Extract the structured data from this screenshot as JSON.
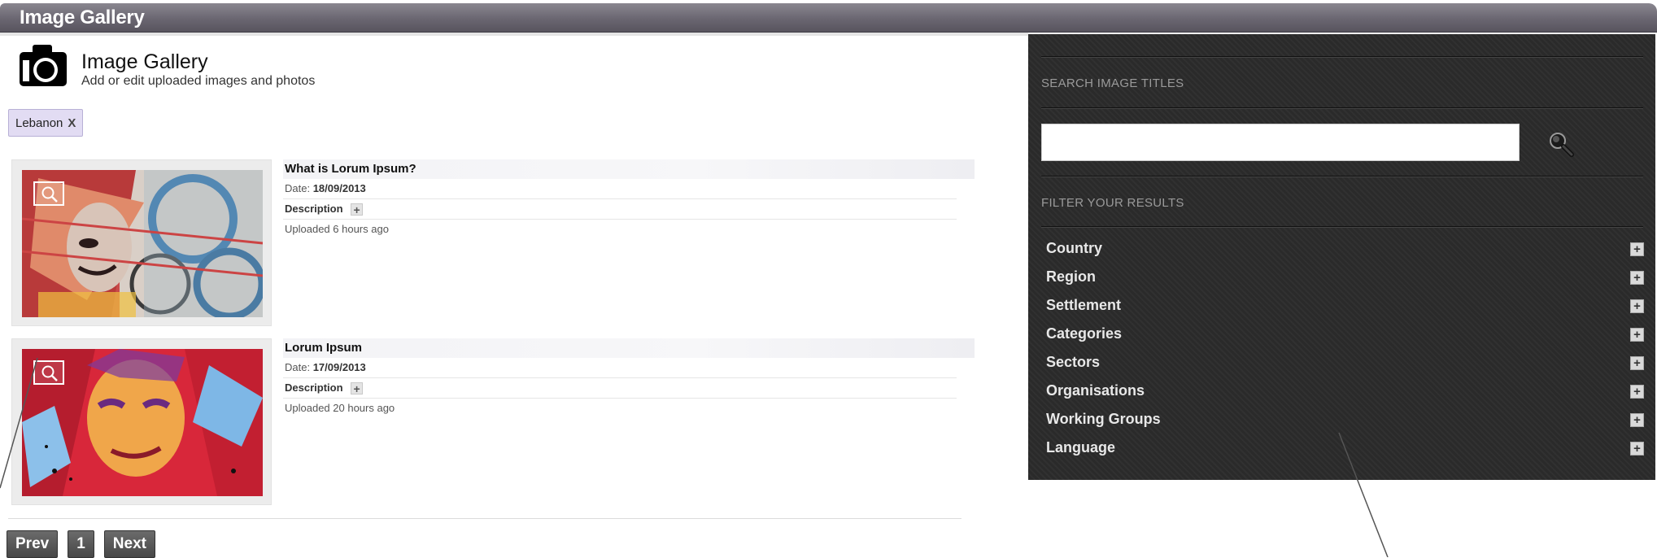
{
  "window": {
    "title": "Image Gallery"
  },
  "header": {
    "title": "Image Gallery",
    "subtitle": "Add or edit uploaded images and photos"
  },
  "active_filter": {
    "label": "Lebanon",
    "remove": "X"
  },
  "items": [
    {
      "title": "What is Lorum Ipsum?",
      "date_label": "Date:",
      "date": "18/09/2013",
      "description_label": "Description",
      "uploaded": "Uploaded 6 hours ago"
    },
    {
      "title": "Lorum Ipsum",
      "date_label": "Date:",
      "date": "17/09/2013",
      "description_label": "Description",
      "uploaded": "Uploaded 20 hours ago"
    }
  ],
  "pagination": {
    "prev": "Prev",
    "page": "1",
    "next": "Next"
  },
  "sidebar": {
    "search_heading": "SEARCH IMAGE TITLES",
    "search_value": "",
    "filter_heading": "FILTER YOUR RESULTS",
    "filters": [
      "Country",
      "Region",
      "Settlement",
      "Categories",
      "Sectors",
      "Organisations",
      "Working Groups",
      "Language"
    ],
    "plus": "+"
  },
  "colors": {
    "titlebar": "#6a6671",
    "sidebar_bg": "#2a2a2a",
    "tag_bg": "#e2dcf3"
  }
}
